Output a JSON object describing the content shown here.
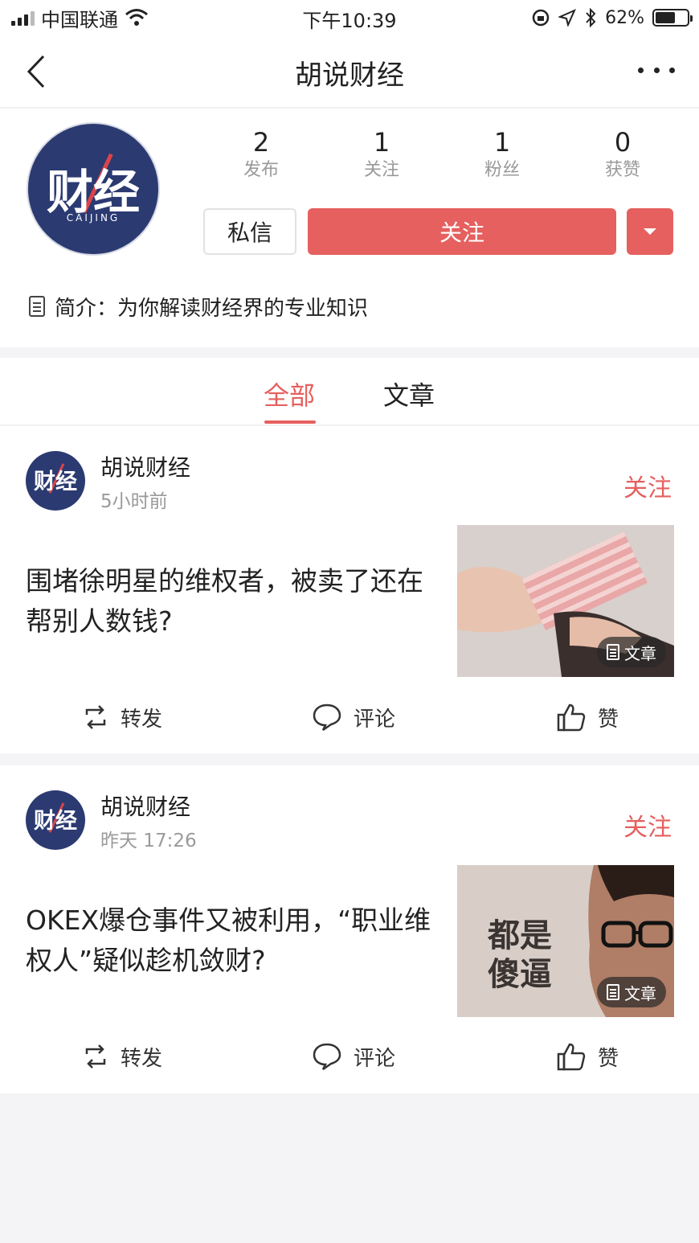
{
  "status_bar": {
    "carrier": "中国联通",
    "time": "下午10:39",
    "battery": "62%",
    "battery_level": 0.62,
    "icons": [
      "signal-icon",
      "wifi-icon",
      "orientation-lock-icon",
      "location-icon",
      "bluetooth-icon",
      "battery-icon"
    ]
  },
  "nav": {
    "title": "胡说财经",
    "icons": [
      "back-icon",
      "more-icon"
    ]
  },
  "profile": {
    "avatar": {
      "logo_text": "财经",
      "logo_sub": "CAIJING"
    },
    "stats": [
      {
        "value": "2",
        "label": "发布"
      },
      {
        "value": "1",
        "label": "关注"
      },
      {
        "value": "1",
        "label": "粉丝"
      },
      {
        "value": "0",
        "label": "获赞"
      }
    ],
    "message_button": "私信",
    "follow_button": "关注",
    "intro": "简介：为你解读财经界的专业知识"
  },
  "tabs": [
    {
      "label": "全部",
      "active": true
    },
    {
      "label": "文章",
      "active": false
    }
  ],
  "colors": {
    "accent": "#e5605e",
    "logo_bg": "#2b3a71",
    "muted": "#9a9a9a"
  },
  "feed": [
    {
      "author": "胡说财经",
      "time": "5小时前",
      "follow": "关注",
      "title": "围堵徐明星的维权者，被卖了还在帮别人数钱?",
      "thumb_badge": "文章",
      "actions": {
        "repost": "转发",
        "comment": "评论",
        "like": "赞"
      }
    },
    {
      "author": "胡说财经",
      "time": "昨天 17:26",
      "follow": "关注",
      "title": "OKEX爆仓事件又被利用，“职业维权人”疑似趁机敛财?",
      "thumb_text_1": "都是",
      "thumb_text_2": "傻逼",
      "thumb_badge": "文章",
      "actions": {
        "repost": "转发",
        "comment": "评论",
        "like": "赞"
      }
    }
  ]
}
